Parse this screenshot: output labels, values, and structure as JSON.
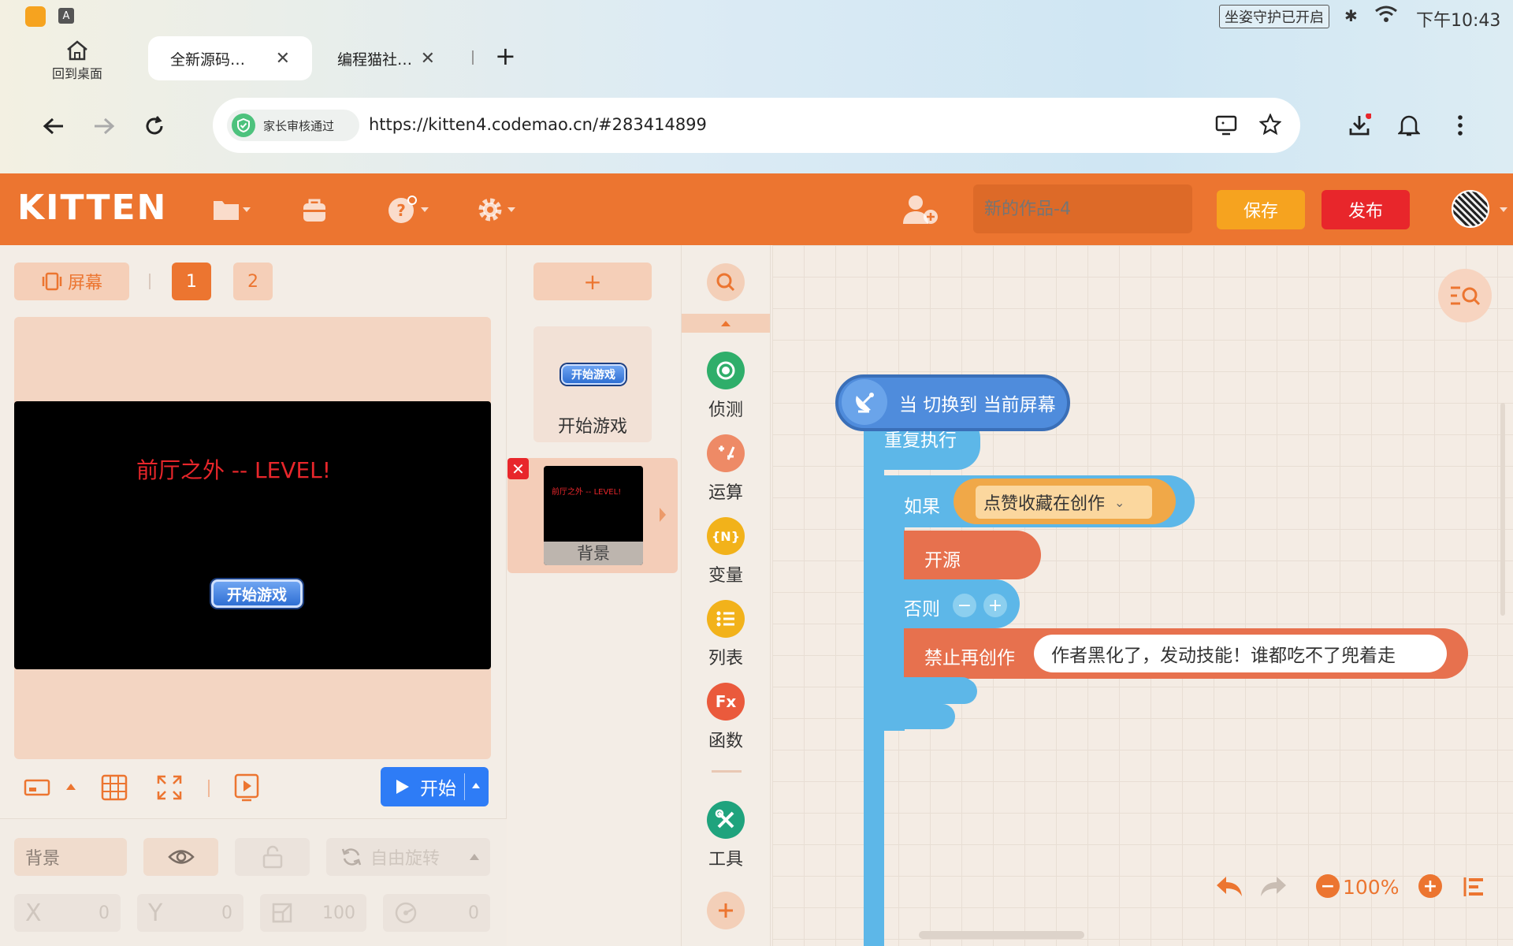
{
  "statusbar": {
    "guard_badge": "坐姿守护已开启",
    "time": "下午10:43"
  },
  "browser": {
    "home_label": "回到桌面",
    "tabs": [
      {
        "label": "全新源码…",
        "active": true
      },
      {
        "label": "编程猫社…",
        "active": false
      }
    ],
    "new_tab": "+",
    "parental_badge": "家长审核通过",
    "url": "https://kitten4.codemao.cn/#283414899"
  },
  "app": {
    "logo": "KITTEN",
    "title_placeholder": "新的作品-4",
    "save_label": "保存",
    "publish_label": "发布"
  },
  "stage_panel": {
    "screen_label": "屏幕",
    "pages": [
      "1",
      "2"
    ],
    "stage_title": "前厅之外 -- LEVEL!",
    "start_game_button": "开始游戏",
    "run_label": "开始",
    "selected_sprite_name": "背景",
    "rotation_mode": "自由旋转",
    "x_label": "X",
    "x_value": "0",
    "y_label": "Y",
    "y_value": "0",
    "size_value": "100",
    "rotation_value": "0"
  },
  "sprites": {
    "add_label": "+",
    "items": [
      {
        "name": "开始游戏",
        "thumb_text": "开始游戏"
      },
      {
        "name": "背景",
        "thumb_text": "前厅之外 -- LEVEL!"
      }
    ]
  },
  "categories": [
    {
      "label": "侦测",
      "color": "#2fae6a",
      "glyph": "◉"
    },
    {
      "label": "运算",
      "color": "#ee8a66",
      "glyph": "±"
    },
    {
      "label": "变量",
      "color": "#f2b21a",
      "glyph": "{N}"
    },
    {
      "label": "列表",
      "color": "#f2b21a",
      "glyph": "≡"
    },
    {
      "label": "函数",
      "color": "#ea5a3c",
      "glyph": "Fx"
    },
    {
      "label": "工具",
      "color": "#1fa37d",
      "glyph": "✕"
    }
  ],
  "blocks": {
    "event": "当 切换到 当前屏幕",
    "repeat": "重复执行",
    "if_label": "如果",
    "condition": "点赞收藏在创作",
    "then_action": "开源",
    "else_label": "否则",
    "else_action": "禁止再创作",
    "else_action_arg": "作者黑化了，发动技能！谁都吃不了兜着走"
  },
  "workspace": {
    "zoom": "100%"
  },
  "colors": {
    "brand": "#ec7530",
    "publish": "#e8262b",
    "save": "#f6a31f",
    "control_block": "#5db7e8",
    "event_block": "#4f8cdc",
    "condition_block": "#f0a848",
    "action_block": "#e7714e"
  }
}
